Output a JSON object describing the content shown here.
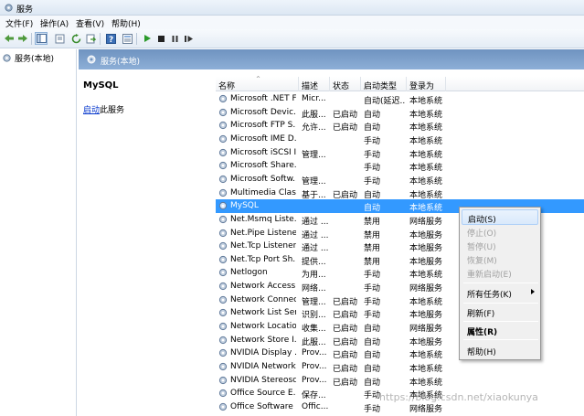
{
  "window": {
    "title": "服务"
  },
  "menu": {
    "items": [
      "文件(F)",
      "操作(A)",
      "查看(V)",
      "帮助(H)"
    ]
  },
  "toolbar": {
    "icons": [
      "back-arrow-icon",
      "forward-arrow-icon",
      "console-tree-icon",
      "properties-icon",
      "refresh-icon",
      "export-icon",
      "help-icon",
      "detail-view-icon",
      "start-service-icon",
      "stop-service-icon",
      "pause-service-icon",
      "restart-service-icon"
    ]
  },
  "tree": {
    "root_label": "服务(本地)"
  },
  "pane": {
    "header_title": "服务(本地)",
    "selected_service": "MySQL",
    "start_link": "启动",
    "start_suffix": "此服务"
  },
  "table": {
    "columns": [
      "名称",
      "描述",
      "状态",
      "启动类型",
      "登录为"
    ],
    "rows": [
      {
        "name": "Microsoft .NET F...",
        "desc": "Micr...",
        "status": "",
        "startup": "自动(延迟...",
        "logon": "本地系统"
      },
      {
        "name": "Microsoft Devic...",
        "desc": "此服...",
        "status": "已启动",
        "startup": "自动",
        "logon": "本地系统"
      },
      {
        "name": "Microsoft FTP S...",
        "desc": "允许...",
        "status": "已启动",
        "startup": "自动",
        "logon": "本地系统"
      },
      {
        "name": "Microsoft IME D...",
        "desc": "",
        "status": "",
        "startup": "手动",
        "logon": "本地系统"
      },
      {
        "name": "Microsoft iSCSI I...",
        "desc": "管理...",
        "status": "",
        "startup": "手动",
        "logon": "本地系统"
      },
      {
        "name": "Microsoft Share...",
        "desc": "",
        "status": "",
        "startup": "手动",
        "logon": "本地系统"
      },
      {
        "name": "Microsoft Softw...",
        "desc": "管理...",
        "status": "",
        "startup": "手动",
        "logon": "本地系统"
      },
      {
        "name": "Multimedia Clas...",
        "desc": "基于...",
        "status": "已启动",
        "startup": "自动",
        "logon": "本地系统"
      },
      {
        "name": "MySQL",
        "desc": "",
        "status": "",
        "startup": "自动",
        "logon": "本地系统",
        "selected": true
      },
      {
        "name": "Net.Msmq Liste...",
        "desc": "通过 ...",
        "status": "",
        "startup": "禁用",
        "logon": "网络服务"
      },
      {
        "name": "Net.Pipe Listene...",
        "desc": "通过 ...",
        "status": "",
        "startup": "禁用",
        "logon": "本地服务"
      },
      {
        "name": "Net.Tcp Listener...",
        "desc": "通过 ...",
        "status": "",
        "startup": "禁用",
        "logon": "本地服务"
      },
      {
        "name": "Net.Tcp Port Sh...",
        "desc": "提供...",
        "status": "",
        "startup": "禁用",
        "logon": "本地服务"
      },
      {
        "name": "Netlogon",
        "desc": "为用...",
        "status": "",
        "startup": "手动",
        "logon": "本地系统"
      },
      {
        "name": "Network Access ...",
        "desc": "网络...",
        "status": "",
        "startup": "手动",
        "logon": "网络服务"
      },
      {
        "name": "Network Connec...",
        "desc": "管理...",
        "status": "已启动",
        "startup": "手动",
        "logon": "本地系统"
      },
      {
        "name": "Network List Ser...",
        "desc": "识别...",
        "status": "已启动",
        "startup": "手动",
        "logon": "本地服务"
      },
      {
        "name": "Network Locatio...",
        "desc": "收集...",
        "status": "已启动",
        "startup": "自动",
        "logon": "网络服务"
      },
      {
        "name": "Network Store I...",
        "desc": "此服...",
        "status": "已启动",
        "startup": "自动",
        "logon": "本地服务"
      },
      {
        "name": "NVIDIA Display ...",
        "desc": "Prov...",
        "status": "已启动",
        "startup": "自动",
        "logon": "本地系统"
      },
      {
        "name": "NVIDIA Network...",
        "desc": "Prov...",
        "status": "已启动",
        "startup": "自动",
        "logon": "本地系统"
      },
      {
        "name": "NVIDIA Stereosc...",
        "desc": "Prov...",
        "status": "已启动",
        "startup": "自动",
        "logon": "本地系统"
      },
      {
        "name": "Office Source E...",
        "desc": "保存...",
        "status": "",
        "startup": "手动",
        "logon": "本地系统"
      },
      {
        "name": "Office Software ...",
        "desc": "Offic...",
        "status": "",
        "startup": "手动",
        "logon": "网络服务"
      }
    ]
  },
  "context_menu": {
    "items": [
      {
        "label": "启动(S)",
        "state": "hover"
      },
      {
        "label": "停止(O)",
        "state": "disabled"
      },
      {
        "label": "暂停(U)",
        "state": "disabled"
      },
      {
        "label": "恢复(M)",
        "state": "disabled"
      },
      {
        "label": "重新启动(E)",
        "state": "disabled"
      },
      {
        "label": "所有任务(K)",
        "state": "normal",
        "submenu": true
      },
      {
        "label": "刷新(F)",
        "state": "normal"
      },
      {
        "label": "属性(R)",
        "state": "bold"
      },
      {
        "label": "帮助(H)",
        "state": "normal"
      }
    ]
  },
  "watermark": "https://blog.csdn.net/xiaokunya",
  "colors": {
    "selection": "#3399ff",
    "header": "#7a9cc8",
    "link": "#0033cc"
  }
}
